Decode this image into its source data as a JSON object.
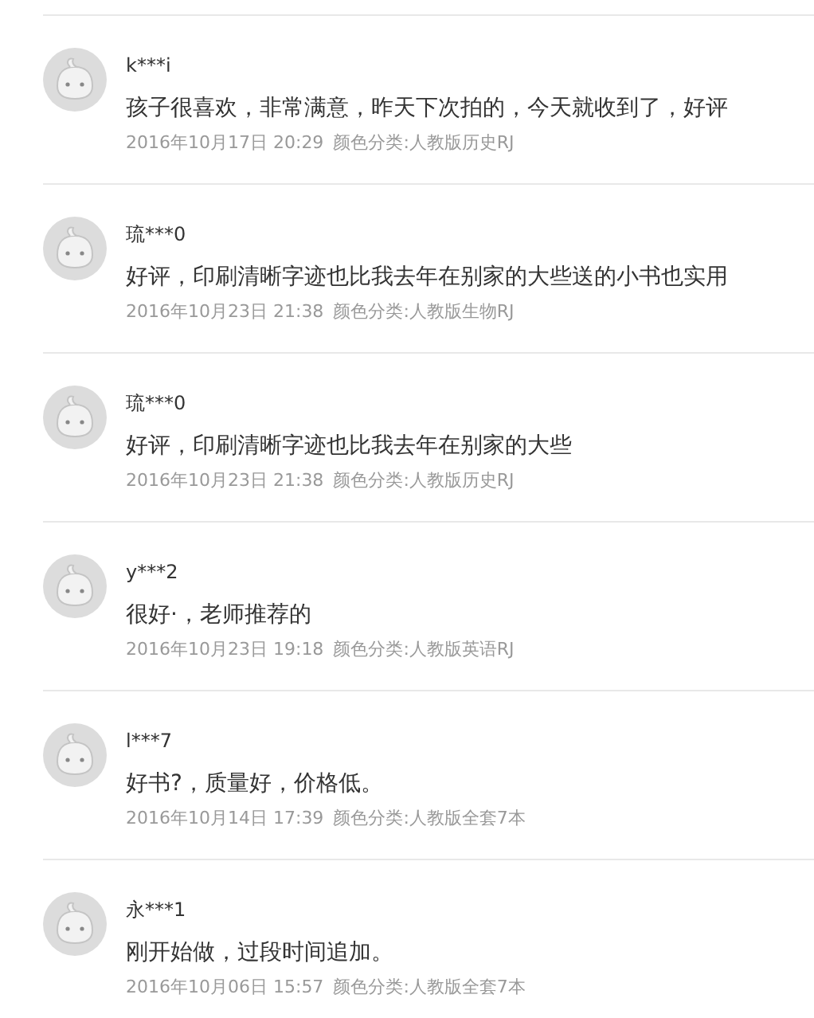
{
  "reviews": [
    {
      "user": "k***i",
      "comment": "孩子很喜欢，非常满意，昨天下次拍的，今天就收到了，好评",
      "date": "2016年10月17日 20:29",
      "sku": "颜色分类:人教版历史RJ"
    },
    {
      "user": "琉***0",
      "comment": "好评，印刷清晰字迹也比我去年在别家的大些送的小书也实用",
      "date": "2016年10月23日 21:38",
      "sku": "颜色分类:人教版生物RJ"
    },
    {
      "user": "琉***0",
      "comment": "好评，印刷清晰字迹也比我去年在别家的大些",
      "date": "2016年10月23日 21:38",
      "sku": "颜色分类:人教版历史RJ"
    },
    {
      "user": "y***2",
      "comment": "很好·，老师推荐的",
      "date": "2016年10月23日 19:18",
      "sku": "颜色分类:人教版英语RJ"
    },
    {
      "user": "l***7",
      "comment": "好书?，质量好，价格低。",
      "date": "2016年10月14日 17:39",
      "sku": "颜色分类:人教版全套7本"
    },
    {
      "user": "永***1",
      "comment": "刚开始做，过段时间追加。",
      "date": "2016年10月06日 15:57",
      "sku": "颜色分类:人教版全套7本"
    }
  ]
}
